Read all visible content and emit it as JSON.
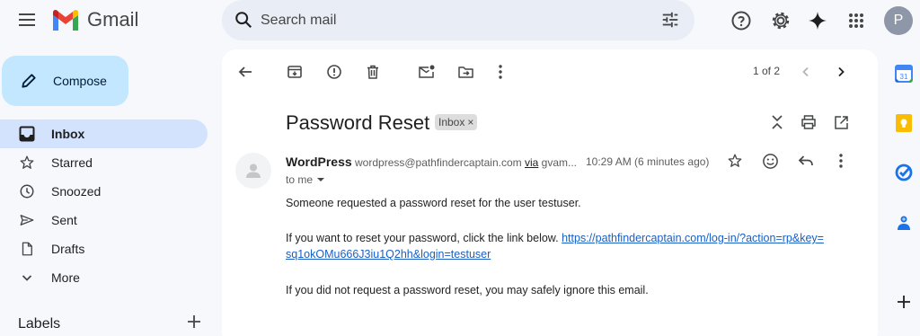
{
  "app": {
    "name": "Gmail",
    "avatar_letter": "P"
  },
  "search": {
    "placeholder": "Search mail"
  },
  "compose": {
    "label": "Compose"
  },
  "nav": [
    {
      "label": "Inbox",
      "icon": "inbox-icon",
      "active": true
    },
    {
      "label": "Starred",
      "icon": "star-icon"
    },
    {
      "label": "Snoozed",
      "icon": "clock-icon"
    },
    {
      "label": "Sent",
      "icon": "send-icon"
    },
    {
      "label": "Drafts",
      "icon": "draft-icon"
    },
    {
      "label": "More",
      "icon": "chevron-down-icon"
    }
  ],
  "labels": {
    "title": "Labels"
  },
  "toolbar": {
    "pager": "1 of 2"
  },
  "email": {
    "subject": "Password Reset",
    "label_chip": "Inbox",
    "sender_name": "WordPress",
    "sender_email": "wordpress@pathfindercaptain.com",
    "via": "via",
    "via_domain": "gvam...",
    "time": "10:29 AM (6 minutes ago)",
    "to": "to me",
    "body": {
      "line1": "Someone requested a password reset for the user testuser.",
      "line2_text": "If you want to reset your password, click the link below.",
      "link_part1": "https://pathfindercaptain.com/log-in/?action=rp&key=",
      "link_part2": "sq1okOMu666J3iu1Q2hh&login=testuser",
      "line3": "If you did not request a password reset, you may safely ignore this email."
    }
  },
  "colors": {
    "background": "#f6f8fc",
    "compose_bg": "#c2e7ff",
    "active_nav": "#d3e3fd",
    "search_bg": "#e9eef6",
    "link": "#1a5fc5"
  }
}
